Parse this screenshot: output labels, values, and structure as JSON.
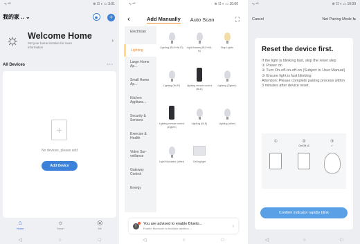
{
  "screen1": {
    "status_left": "ᵊᵢₗ ⁴ᴳ",
    "status_right": "⊛ ☷ ◐ ▭ 3:01",
    "home_selector": "我的家 .. ⌄",
    "welcome_title": "Welcome Home",
    "welcome_subtitle": "Set your home location for more information",
    "all_devices_label": "All Devices",
    "more_dots": "···",
    "empty_text": "No devices, please add",
    "add_device_label": "Add Device",
    "tabs": [
      {
        "label": "Home",
        "icon": "home-icon",
        "glyph": "⌂"
      },
      {
        "label": "Smart",
        "icon": "sun-icon",
        "glyph": "☼"
      },
      {
        "label": "Me",
        "icon": "person-icon",
        "glyph": "◎"
      }
    ],
    "accent_color": "#3b82d8"
  },
  "screen2": {
    "status_left": "ᵊᵢₗ ⁴ᴳ",
    "status_right": "⊛ ☷ ◐ ▭ 10:00",
    "tab_manual": "Add Manually",
    "tab_scan": "Auto Scan",
    "categories": [
      "Electrician",
      "Lighting",
      "Large Home Ap...",
      "Small Home Ap...",
      "Kitchen Applianc...",
      "Security & Sensors",
      "Exercise & Health",
      "Video Sur-veillance",
      "Gateway Control",
      "Energy"
    ],
    "active_category": "Lighting",
    "devices": [
      {
        "label": "Lighting (BLE+Wi-Fi)",
        "icon": "bulb"
      },
      {
        "label": "Light fixtures (BLE+Wi-Fi)",
        "icon": "bulb"
      },
      {
        "label": "Strip Lights",
        "icon": "bulb-gold"
      },
      {
        "label": "Lighting (Wi-Fi)",
        "icon": "bulb"
      },
      {
        "label": "Lighting remote control (BLE)",
        "icon": "remote"
      },
      {
        "label": "Lighting (Zigbee)",
        "icon": "bulb"
      },
      {
        "label": "Lighting remote control (Zigbee)",
        "icon": "remote"
      },
      {
        "label": "Lighting (BLE)",
        "icon": "bulb"
      },
      {
        "label": "Lighting (other)",
        "icon": "bulb"
      },
      {
        "label": "Light Modulator (other)",
        "icon": "bulb"
      },
      {
        "label": "Ceiling light",
        "icon": "strip"
      }
    ],
    "bt_title": "You are advised to enable Blueto...",
    "bt_subtitle": "Enable Bluetooth to facilitate addition ..."
  },
  "screen3": {
    "status_left": "ᵊᵢₗ ⁴ᴳ",
    "status_right": "⊛ ☷ ◐ ▭ 10:00",
    "cancel_label": "Cancel",
    "mode_label": "Net Pairing Mode ⇆",
    "title": "Reset the device first.",
    "body": "If the light is blinking fast, skip the reset step\n① Power on\n② Turn On-off-on-off-on (Subject to User Manual)\n③ Ensure light is fast blinking\nAttention: Please complete pairing process within 3 minutes after device reset.",
    "step_marks": [
      "①",
      "②",
      "③"
    ],
    "step_label": "On/Off x3",
    "confirm_label": "Confirm indicator rapidly blink",
    "confirm_color": "#5aa0e6"
  }
}
